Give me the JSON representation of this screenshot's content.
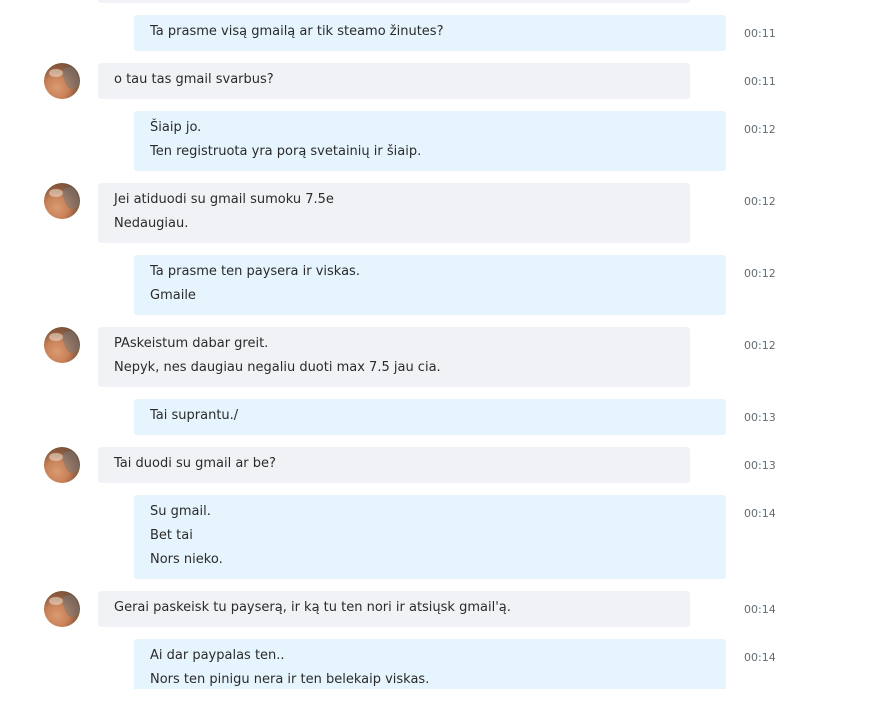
{
  "conversation": {
    "messages": [
      {
        "id": "m1",
        "direction": "outgoing",
        "lines": [
          "Ta prasme visą gmailą ar tik steamo žinutes?"
        ],
        "time": "00:11"
      },
      {
        "id": "m2",
        "direction": "incoming",
        "lines": [
          "o tau tas gmail svarbus?"
        ],
        "time": "00:11"
      },
      {
        "id": "m3",
        "direction": "outgoing",
        "lines": [
          "Šiaip jo.",
          "Ten registruota yra porą svetainių ir šiaip."
        ],
        "time": "00:12"
      },
      {
        "id": "m4",
        "direction": "incoming",
        "lines": [
          "Jei atiduodi su gmail sumoku 7.5e",
          "Nedaugiau."
        ],
        "time": "00:12"
      },
      {
        "id": "m5",
        "direction": "outgoing",
        "lines": [
          "Ta prasme ten paysera ir viskas.",
          "Gmaile"
        ],
        "time": "00:12"
      },
      {
        "id": "m6",
        "direction": "incoming",
        "lines": [
          "PAskeistum dabar greit.",
          "Nepyk, nes daugiau negaliu duoti max 7.5 jau cia."
        ],
        "time": "00:12"
      },
      {
        "id": "m7",
        "direction": "outgoing",
        "lines": [
          "Tai suprantu./"
        ],
        "time": "00:13"
      },
      {
        "id": "m8",
        "direction": "incoming",
        "lines": [
          "Tai duodi su gmail ar be?"
        ],
        "time": "00:13"
      },
      {
        "id": "m9",
        "direction": "outgoing",
        "lines": [
          "Su gmail.",
          "Bet tai",
          "Nors nieko."
        ],
        "time": "00:14"
      },
      {
        "id": "m10",
        "direction": "incoming",
        "lines": [
          "Gerai paskeisk tu payserą, ir ką tu ten nori ir atsiųsk gmail'ą."
        ],
        "time": "00:14"
      },
      {
        "id": "m11",
        "direction": "outgoing",
        "lines": [
          "Ai dar paypalas ten..",
          "Nors ten pinigu nera ir ten belekaip viskas."
        ],
        "time": "00:14"
      }
    ]
  },
  "colors": {
    "outgoing_bubble": "#e5f4fd",
    "incoming_bubble": "#f1f2f6",
    "timestamp": "#5f6c74",
    "text": "#2b2b2b"
  }
}
